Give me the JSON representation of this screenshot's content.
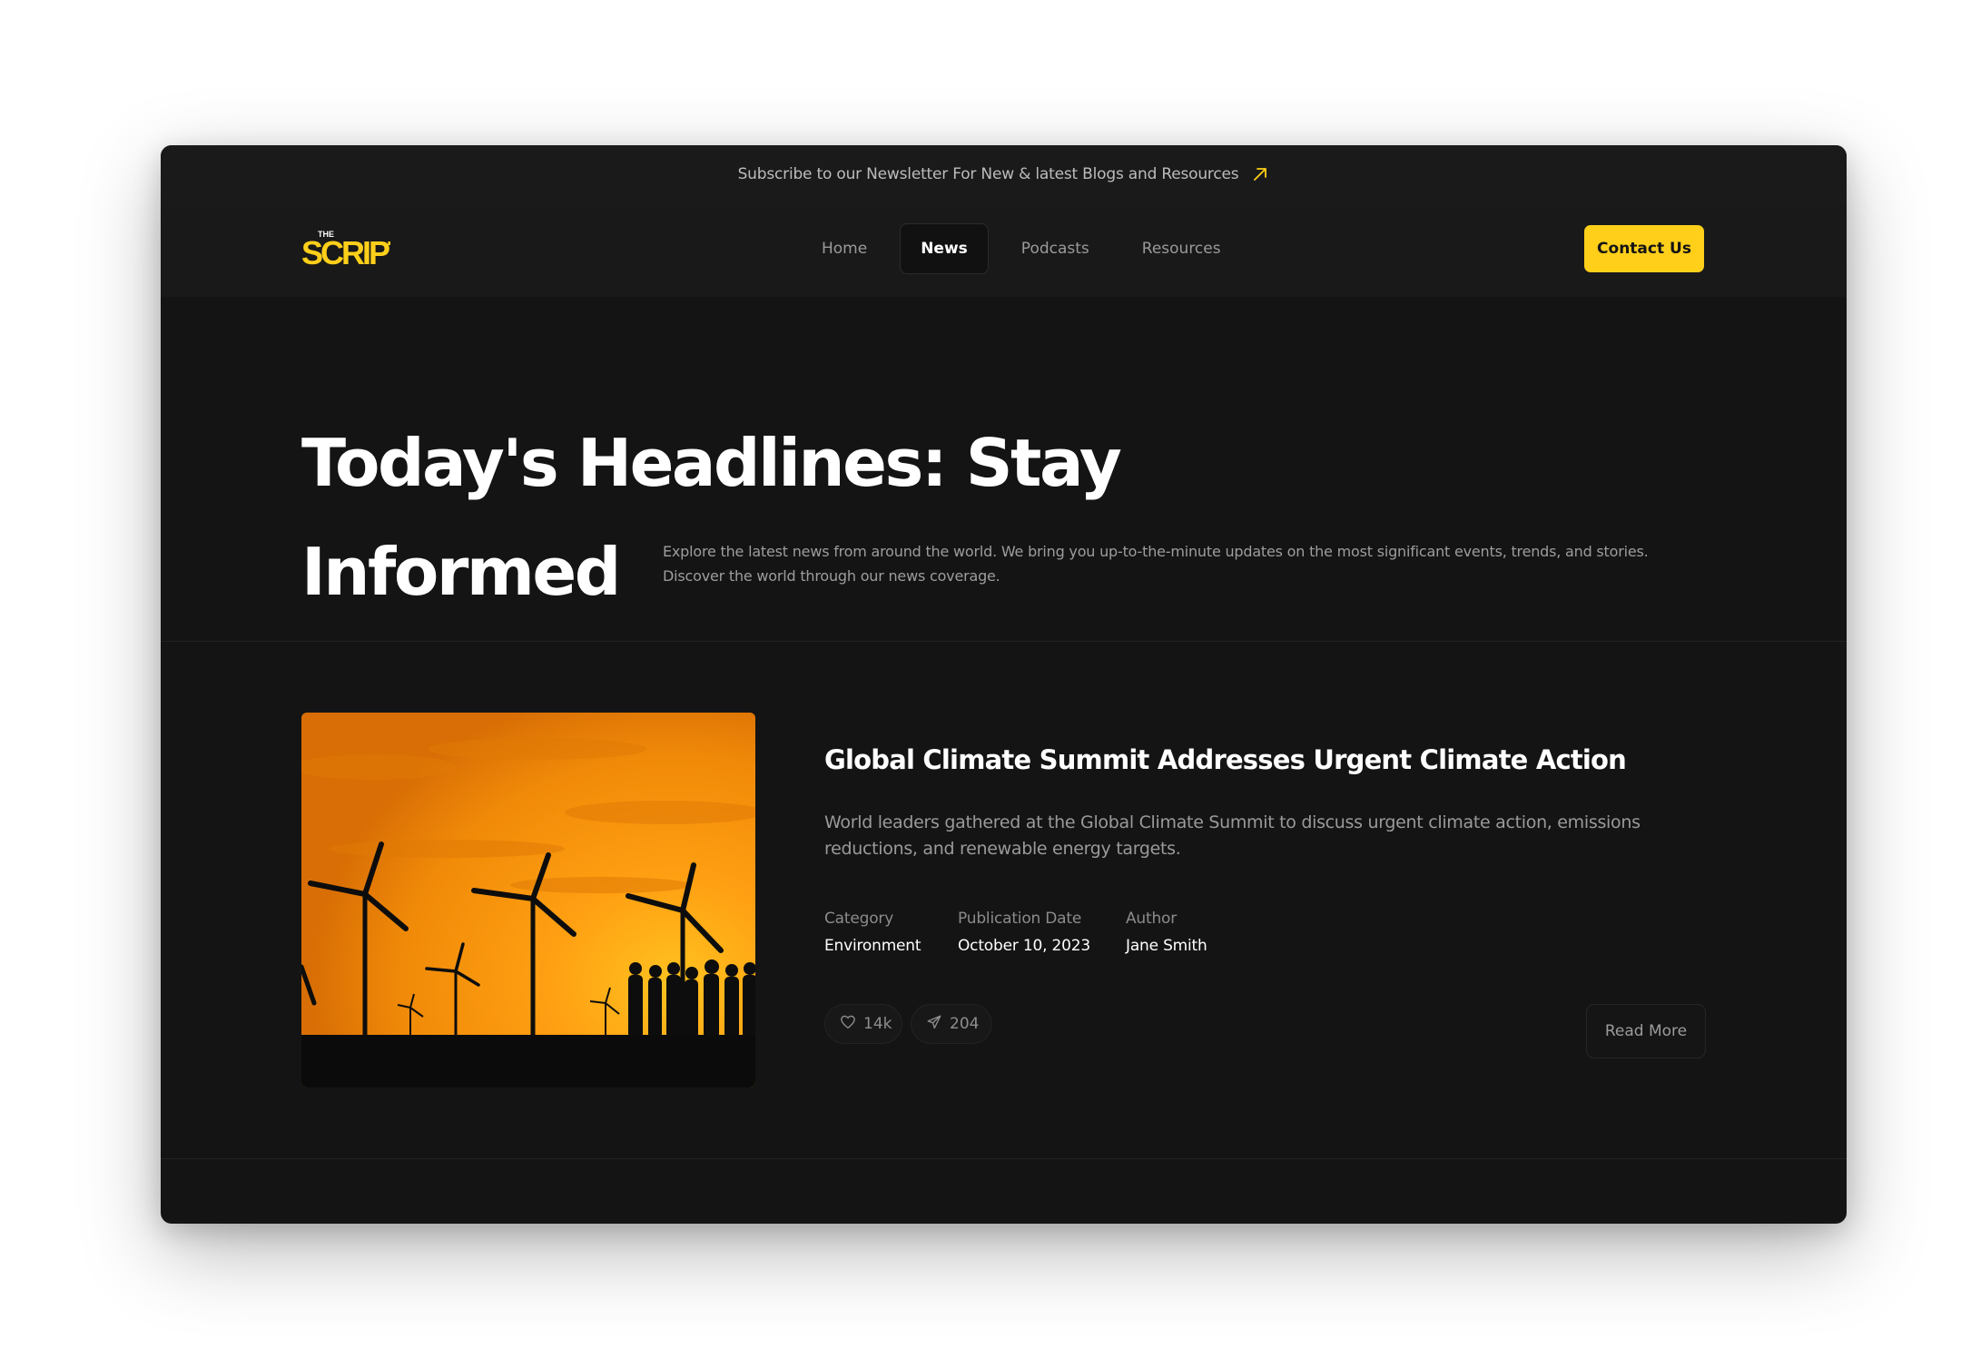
{
  "announcement": {
    "text": "Subscribe to our Newsletter For New & latest Blogs and Resources",
    "icon": "arrow-up-right-icon"
  },
  "brand": {
    "name": "THE SCRIPT",
    "color": "#ffcf1a"
  },
  "nav": {
    "items": [
      {
        "label": "Home",
        "active": false
      },
      {
        "label": "News",
        "active": true
      },
      {
        "label": "Podcasts",
        "active": false
      },
      {
        "label": "Resources",
        "active": false
      }
    ],
    "contact_label": "Contact Us"
  },
  "hero": {
    "title_line1": "Today's Headlines: Stay",
    "title_line2": "Informed",
    "description": "Explore the latest news from around the world. We bring you up-to-the-minute updates on the most significant events, trends, and stories. Discover the world through our news coverage."
  },
  "article": {
    "title": "Global Climate Summit Addresses Urgent Climate Action",
    "summary": "World leaders gathered at the Global Climate Summit to discuss urgent climate action, emissions reductions, and renewable energy targets.",
    "meta": [
      {
        "label": "Category",
        "value": "Environment"
      },
      {
        "label": "Publication Date",
        "value": "October 10, 2023"
      },
      {
        "label": "Author",
        "value": "Jane Smith"
      }
    ],
    "likes": "14k",
    "shares": "204",
    "read_more_label": "Read More"
  },
  "colors": {
    "accent": "#ffcf1a",
    "background": "#141414"
  }
}
